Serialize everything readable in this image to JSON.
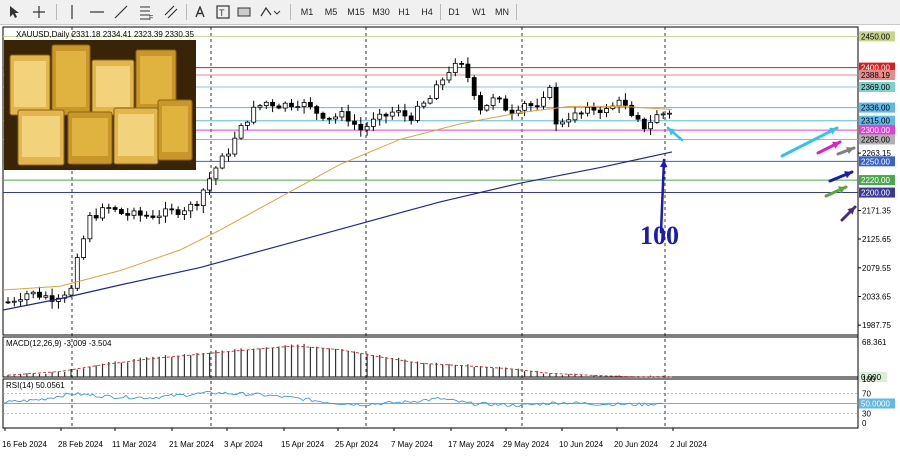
{
  "toolbar": {
    "tools": [
      "cursor-tool",
      "crosshair-tool",
      "vertical-line-tool",
      "horizontal-line-tool",
      "trendline-tool",
      "fibonacci-tool",
      "text-tool",
      "label-tool",
      "shapes-tool"
    ],
    "timeframes": [
      "M1",
      "M5",
      "M15",
      "M30",
      "H1",
      "H4",
      "D1",
      "W1",
      "MN"
    ],
    "active_timeframe": "D1"
  },
  "chart_header": "XAUUSD,Daily  2331.18 2334.41 2323.39 2330.35",
  "annotation_text": "100",
  "chart_data": [
    {
      "type": "candlestick",
      "symbol": "XAUUSD",
      "timeframe": "Daily",
      "ohlc_last": {
        "open": 2331.18,
        "high": 2334.41,
        "low": 2323.39,
        "close": 2330.35
      },
      "y_tick_labels": [
        "2450.00",
        "2400.00",
        "2388.19",
        "2369.00",
        "2336.00",
        "2315.00",
        "2300.00",
        "2285.00",
        "2263.15",
        "2250.00",
        "2220.00",
        "2200.00",
        "2171.35",
        "2125.65",
        "2079.55",
        "2033.65",
        "1987.75"
      ],
      "x_tick_labels": [
        "16 Feb 2024",
        "28 Feb 2024",
        "11 Mar 2024",
        "21 Mar 2024",
        "3 Apr 2024",
        "15 Apr 2024",
        "25 Apr 2024",
        "7 May 2024",
        "17 May 2024",
        "29 May 2024",
        "10 Jun 2024",
        "20 Jun 2024",
        "2 Jul 2024"
      ],
      "horizontal_levels": [
        {
          "value": 2450,
          "label": "2450.00",
          "color": "#c8d38a"
        },
        {
          "value": 2400,
          "label": "2400.00",
          "color": "#d42020"
        },
        {
          "value": 2388.19,
          "label": "2388.19",
          "color": "#e88a8a"
        },
        {
          "value": 2369,
          "label": "2369.00",
          "color": "#7fd0c8"
        },
        {
          "value": 2336,
          "label": "2336.00",
          "color": "#5fb8e6"
        },
        {
          "value": 2315,
          "label": "2315.00",
          "color": "#5fb8e6"
        },
        {
          "value": 2300,
          "label": "2300.00",
          "color": "#e040d0"
        },
        {
          "value": 2285,
          "label": "2285.00",
          "color": "#b0b0b0"
        },
        {
          "value": 2250,
          "label": "2250.00",
          "color": "#3a62c8"
        },
        {
          "value": 2220,
          "label": "2220.00",
          "color": "#4aa84a"
        },
        {
          "value": 2200,
          "label": "2200.00",
          "color": "#3a3a9a"
        }
      ],
      "price_range": [
        1972,
        2465
      ],
      "moving_averages": [
        {
          "period": 100,
          "color": "#1f2a8a"
        },
        {
          "period": 50,
          "color": "#d9a43a"
        }
      ]
    },
    {
      "type": "macd-histogram",
      "title": "MACD(12,26,9) -3.009 -3.504",
      "y_tick_labels": [
        "68.361",
        "0.000"
      ],
      "range": [
        0,
        75
      ]
    },
    {
      "type": "line",
      "title": "RSI(14) 50.0561",
      "y_tick_labels": [
        "100",
        "70",
        "50.0000",
        "30",
        "0"
      ],
      "ylim": [
        0,
        100
      ],
      "levels": [
        70,
        50,
        30
      ]
    }
  ],
  "colors": {
    "bull": "#ffffff",
    "bear": "#000000",
    "grid": "#000000",
    "annotation": "#1a1ab4",
    "arrow_cyan": "#33c5e8",
    "arrow_magenta": "#e020c0",
    "arrow_gray": "#808080",
    "arrow_blue": "#1a1ab4",
    "arrow_green": "#5aa830",
    "arrow_purple": "#4a2a8a"
  }
}
